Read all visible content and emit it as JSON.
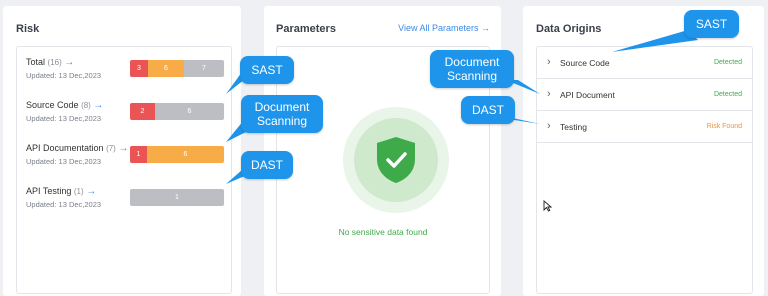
{
  "risk": {
    "title": "Risk",
    "rows": [
      {
        "name": "Total",
        "count": "(16)",
        "arrow": "→",
        "date": "Updated: 13 Dec,2023",
        "segments": [
          {
            "v": "3",
            "c": "red",
            "w": 18
          },
          {
            "v": "6",
            "c": "orange",
            "w": 36
          },
          {
            "v": "7",
            "c": "gray",
            "w": 40
          }
        ]
      },
      {
        "name": "Source Code",
        "count": "(8)",
        "arrow": "→",
        "date": "Updated: 13 Dec,2023",
        "segments": [
          {
            "v": "2",
            "c": "red",
            "w": 25
          },
          {
            "v": "6",
            "c": "gray",
            "w": 69
          }
        ]
      },
      {
        "name": "API Documentation",
        "count": "(7)",
        "arrow": "→",
        "date": "Updated: 13 Dec,2023",
        "segments": [
          {
            "v": "1",
            "c": "red",
            "w": 17
          },
          {
            "v": "6",
            "c": "orange",
            "w": 77
          }
        ]
      },
      {
        "name": "API Testing",
        "count": "(1)",
        "arrow": "→",
        "date": "Updated: 13 Dec,2023",
        "segments": [
          {
            "v": "1",
            "c": "gray",
            "w": 94
          }
        ]
      }
    ]
  },
  "parameters": {
    "title": "Parameters",
    "view_all": "View All Parameters →",
    "empty_text": "No sensitive data found"
  },
  "origins": {
    "title": "Data Origins",
    "items": [
      {
        "name": "Source Code",
        "status": "Detected",
        "tone": "green"
      },
      {
        "name": "API Document",
        "status": "Detected",
        "tone": "green"
      },
      {
        "name": "Testing",
        "status": "Risk Found",
        "tone": "orange"
      }
    ]
  },
  "callouts": {
    "sast_left": "SAST",
    "doc_left": "Document Scanning",
    "dast_left": "DAST",
    "sast_right": "SAST",
    "doc_right": "Document Scanning",
    "dast_right": "DAST"
  },
  "colors": {
    "red": "#ea5455",
    "orange": "#f8ac48",
    "gray": "#bcbec3",
    "green": "#3faa4a",
    "blue": "#3d8be8",
    "callout": "#1e95ea"
  }
}
